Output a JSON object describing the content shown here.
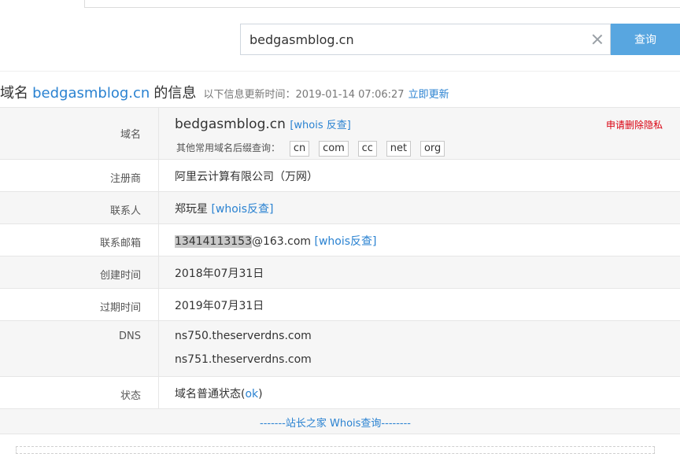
{
  "search": {
    "value": "bedgasmblog.cn",
    "button_label": "查询"
  },
  "heading": {
    "prefix": "域名",
    "domain": "bedgasmblog.cn",
    "suffix": "的信息",
    "updated_text": "以下信息更新时间：2019-01-14 07:06:27",
    "refresh_link": "立即更新"
  },
  "rows": {
    "domain": {
      "label": "域名",
      "value": "bedgasmblog.cn",
      "whois_link": "[whois 反查]",
      "privacy_link": "申请删除隐私",
      "suffix_prompt": "其他常用域名后缀查询：",
      "suffixes": [
        "cn",
        "com",
        "cc",
        "net",
        "org"
      ]
    },
    "registrar": {
      "label": "注册商",
      "value": "阿里云计算有限公司（万网）"
    },
    "contact": {
      "label": "联系人",
      "value": "郑玩星",
      "whois_link": "[whois反查]"
    },
    "email": {
      "label": "联系邮箱",
      "value_highlight": "13414113153",
      "value_rest": "@163.com",
      "whois_link": "[whois反查]"
    },
    "created": {
      "label": "创建时间",
      "value": "2018年07月31日"
    },
    "expires": {
      "label": "过期时间",
      "value": "2019年07月31日"
    },
    "dns": {
      "label": "DNS",
      "servers": [
        "ns750.theserverdns.com",
        "ns751.theserverdns.com"
      ]
    },
    "status": {
      "label": "状态",
      "prefix": "域名普通状态(",
      "link": "ok",
      "suffix": ")"
    }
  },
  "footer": {
    "link": "-------站长之家 Whois查询--------"
  }
}
